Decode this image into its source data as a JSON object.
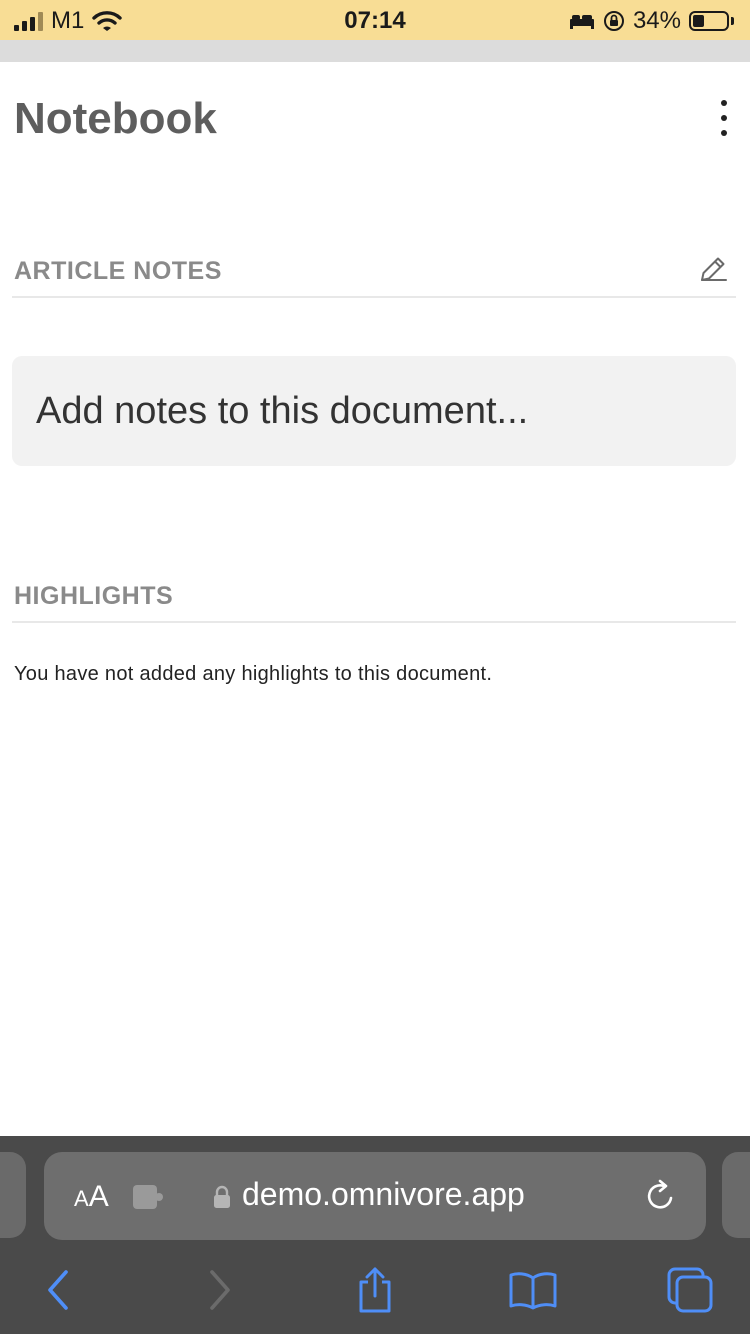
{
  "status_bar": {
    "carrier": "M1",
    "time": "07:14",
    "battery_percent": "34%",
    "battery_level": 0.34,
    "icons": [
      "signal-icon",
      "wifi-icon",
      "bed-icon",
      "orientation-lock-icon",
      "battery-icon"
    ]
  },
  "header": {
    "title": "Notebook",
    "menu_icon": "more-vertical-icon"
  },
  "article_notes": {
    "label": "ARTICLE NOTES",
    "edit_icon": "pencil-icon",
    "placeholder": "Add notes to this document..."
  },
  "highlights": {
    "label": "HIGHLIGHTS",
    "empty_message": "You have not added any highlights to this document."
  },
  "browser": {
    "reader_label_small": "A",
    "reader_label_big": "A",
    "url": "demo.omnivore.app",
    "icons": [
      "extension-icon",
      "lock-icon",
      "reload-icon"
    ]
  },
  "toolbar": {
    "items": [
      "back-icon",
      "forward-icon",
      "share-icon",
      "bookmarks-icon",
      "tabs-icon"
    ]
  },
  "colors": {
    "status_bar_bg": "#f8dd95",
    "safari_accent": "#4f8ef7",
    "section_label": "#8a8a8a"
  }
}
